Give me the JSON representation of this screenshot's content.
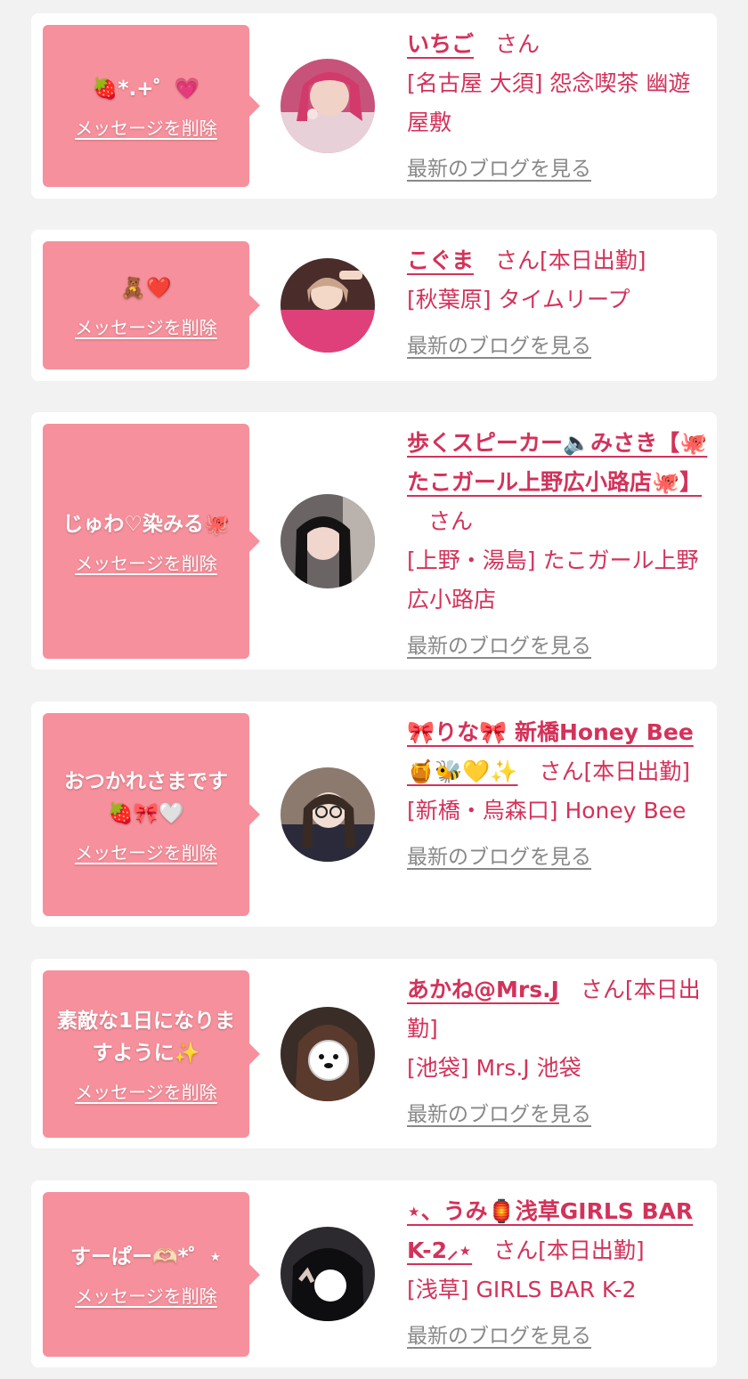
{
  "colors": {
    "accent": "#d3325a",
    "bubble": "#f6909c",
    "muted": "#888888",
    "background": "#f2f2f2"
  },
  "common": {
    "delete_label": "メッセージを削除",
    "blog_label": "最新のブログを見る"
  },
  "items": [
    {
      "message": "🍓*.+゜💗",
      "name": "いちご",
      "san": "さん",
      "shop": "[名古屋 大須] 怨念喫茶 幽遊屋敷",
      "avatar_icon": "avatar-photo"
    },
    {
      "message": "🧸❤️",
      "name": "こぐま",
      "san": "さん[本日出勤]",
      "shop": "[秋葉原] タイムリープ",
      "avatar_icon": "avatar-photo"
    },
    {
      "message": "じゅわ♡染みる🐙",
      "name": "歩くスピーカー🔈みさき【🐙たこガール上野広小路店🐙】",
      "san": "さん",
      "shop": "[上野・湯島] たこガール上野広小路店",
      "avatar_icon": "avatar-photo"
    },
    {
      "message": "おつかれさまです🍓🎀🤍",
      "name": "🎀りな🎀 新橋Honey Bee 🍯🐝💛✨",
      "san": "さん[本日出勤]",
      "shop": "[新橋・烏森口] Honey Bee",
      "avatar_icon": "avatar-photo"
    },
    {
      "message": "素敵な1日になりますように✨",
      "name": "あかね@Mrs.J",
      "san": "さん[本日出勤]",
      "shop": "[池袋] Mrs.J 池袋",
      "avatar_icon": "avatar-photo"
    },
    {
      "message": "すーぱー🫶🏻*゜⋆",
      "name": "⋆、うみ🏮浅草GIRLS BAR K-2⸝⋆",
      "san": "さん[本日出勤]",
      "shop": "[浅草] GIRLS BAR K-2",
      "avatar_icon": "avatar-photo"
    }
  ]
}
